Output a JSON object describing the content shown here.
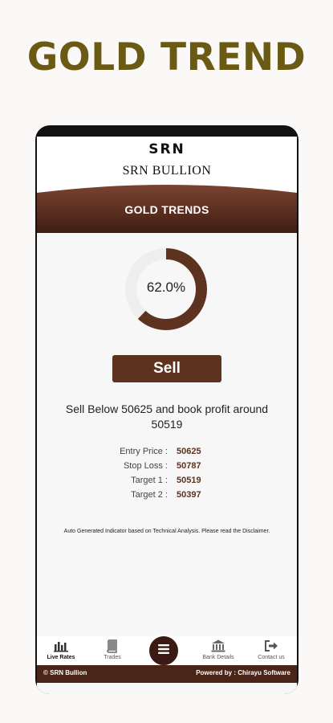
{
  "headline": "GOLD TREND",
  "app": {
    "logo": "SRN",
    "brand": "SRN BULLION",
    "page_title": "GOLD TRENDS"
  },
  "signal": {
    "confidence_label": "62.0%",
    "confidence_fraction": 0.62,
    "action": "Sell",
    "advice": "Sell Below 50625 and book profit around 50519",
    "levels": [
      {
        "label": "Entry Price :",
        "value": "50625"
      },
      {
        "label": "Stop Loss :",
        "value": "50787"
      },
      {
        "label": "Target 1 :",
        "value": "50519"
      },
      {
        "label": "Target 2 :",
        "value": "50397"
      }
    ],
    "disclaimer": "Auto Generated Indicator based on Technical Analysis. Please read the Disclaimer."
  },
  "nav": {
    "live_rates": "Live Rates",
    "trades": "Trades",
    "bank_details": "Bank Details",
    "contact_us": "Contact us"
  },
  "footer": {
    "copyright": "© SRN Bullion",
    "powered_by": "Powered by : Chirayu Software"
  },
  "colors": {
    "brand_brown": "#5d3320",
    "headline": "#6b5a14",
    "ring_track": "#eeeeee"
  },
  "icons": {
    "live_rates": "bar-chart-icon",
    "trades": "book-icon",
    "menu": "menu-icon",
    "bank_details": "bank-icon",
    "contact_us": "sign-out-icon"
  }
}
